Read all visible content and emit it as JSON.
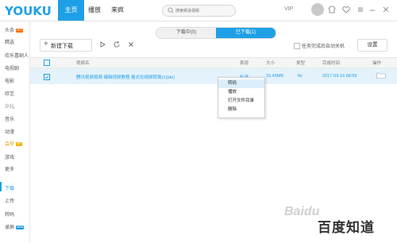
{
  "app": {
    "logo_text": "YOUKU"
  },
  "top_nav": {
    "tabs": [
      "主页",
      "播放",
      "来疯"
    ],
    "active_index": 0
  },
  "search": {
    "placeholder": "搜索频道视频"
  },
  "header_right": {
    "vip_label": "VIP"
  },
  "sidebar": {
    "items": [
      {
        "label": "头条",
        "badge": "HOT"
      },
      {
        "label": "精选"
      },
      {
        "label": "欢乐喜剧人"
      },
      {
        "label": "电视剧"
      },
      {
        "label": "电影"
      },
      {
        "label": "综艺"
      },
      {
        "label": "少儿"
      },
      {
        "label": "音乐"
      },
      {
        "label": "动漫"
      },
      {
        "label": "会员",
        "badge": "VIP"
      },
      {
        "label": "游戏"
      },
      {
        "label": "更多"
      },
      {
        "label": "下载"
      },
      {
        "label": "上传"
      },
      {
        "label": "转码"
      },
      {
        "label": "录屏",
        "badge": "NEW"
      }
    ],
    "active_label": "下载"
  },
  "toolbar": {
    "new_download_label": "新建下载",
    "segments": [
      "下载中(0)",
      "已下载(1)"
    ],
    "active_segment": 1,
    "auto_shutdown_label": "任务完成后自动关机",
    "settings_label": "设置"
  },
  "table": {
    "columns": [
      "视频名",
      "表现",
      "大小",
      "类型",
      "完成时间",
      "操作"
    ],
    "rows": [
      {
        "name": "腾讯视频视频 编辑视频教程 格式化视频转换(1)(de)",
        "status": "标清",
        "size": "16.45MB",
        "type": "flv",
        "completed": "2017-03-16 08:59"
      }
    ]
  },
  "context_menu": {
    "items": [
      "转码",
      "播放",
      "打开文件目录",
      "删除"
    ],
    "hover_index": 0
  },
  "watermark": {
    "text": "百度知道",
    "site": "Baidu"
  },
  "colors": {
    "accent": "#1fa0e6",
    "hot": "#ff6a00"
  }
}
